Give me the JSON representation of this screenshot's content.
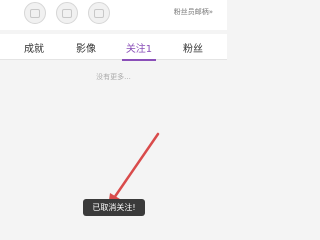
{
  "header": {
    "fan_link": "粉丝员邮柄»"
  },
  "tabs": [
    {
      "label": "成就",
      "active": false
    },
    {
      "label": "影像",
      "active": false
    },
    {
      "label": "关注1",
      "active": true
    },
    {
      "label": "粉丝",
      "active": false
    }
  ],
  "content": {
    "empty_text": "没有更多..."
  },
  "toast": {
    "text": "已取消关注!"
  },
  "colors": {
    "accent": "#8a4fb8",
    "annotation_arrow": "#d94b4b",
    "toast_bg": "#3a3a3a"
  }
}
